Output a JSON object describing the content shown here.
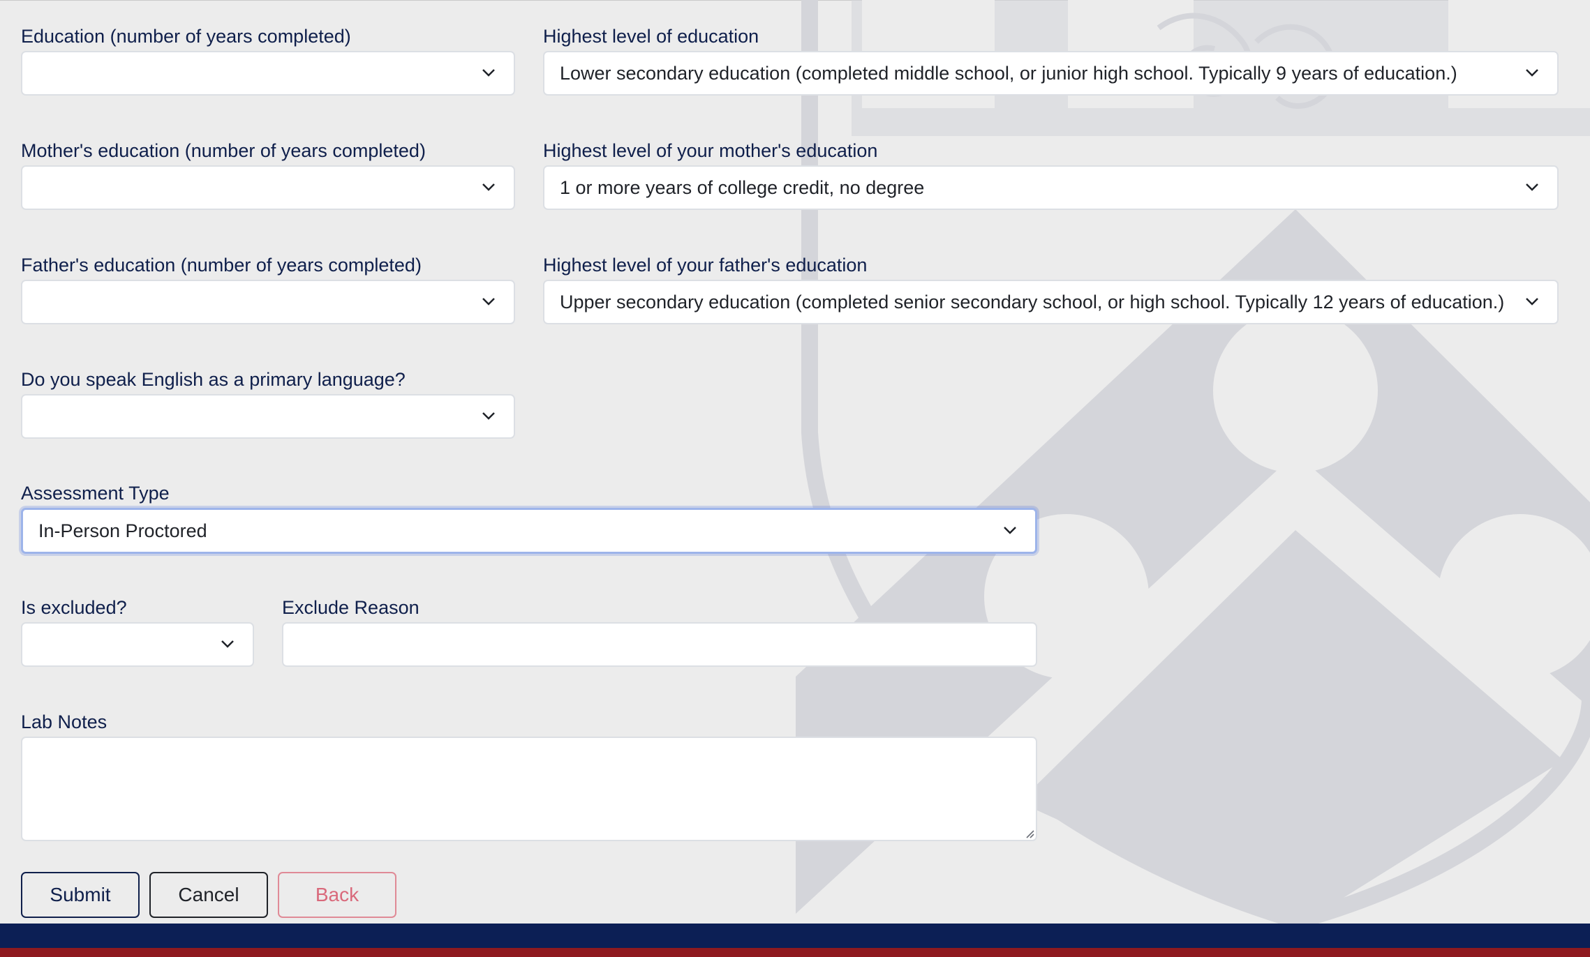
{
  "form": {
    "education_years": {
      "label": "Education (number of years completed)",
      "value": ""
    },
    "education_level": {
      "label": "Highest level of education",
      "value": "Lower secondary education (completed middle school, or junior high school. Typically 9 years of education.)"
    },
    "mother_years": {
      "label": "Mother's education (number of years completed)",
      "value": ""
    },
    "mother_level": {
      "label": "Highest level of your mother's education",
      "value": "1 or more years of college credit, no degree"
    },
    "father_years": {
      "label": "Father's education (number of years completed)",
      "value": ""
    },
    "father_level": {
      "label": "Highest level of your father's education",
      "value": "Upper secondary education (completed senior secondary school, or high school. Typically 12 years of education.)"
    },
    "english_primary": {
      "label": "Do you speak English as a primary language?",
      "value": ""
    },
    "assessment_type": {
      "label": "Assessment Type",
      "value": "In-Person Proctored"
    },
    "is_excluded": {
      "label": "Is excluded?",
      "value": ""
    },
    "exclude_reason": {
      "label": "Exclude Reason",
      "value": ""
    },
    "lab_notes": {
      "label": "Lab Notes",
      "value": ""
    }
  },
  "buttons": {
    "submit": "Submit",
    "cancel": "Cancel",
    "back": "Back"
  },
  "colors": {
    "label_text": "#0f1f4b",
    "footer_navy": "#0c1f55",
    "footer_red": "#8f1a1f",
    "back_button": "#d9697b",
    "focus_ring": "#9db4ea"
  },
  "icons": {
    "select_arrow": "chevron-down-icon",
    "watermark": "university-shield-icon"
  }
}
